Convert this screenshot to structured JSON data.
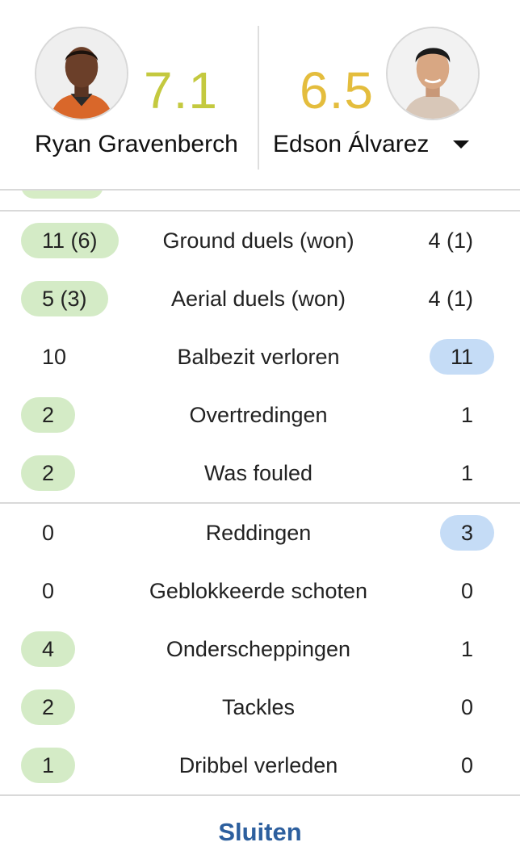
{
  "colors": {
    "rating_left": "#c4c93f",
    "rating_right": "#e4bd3d",
    "pill_green": "#d4ebc6",
    "pill_blue": "#c5dcf6",
    "close_button": "#2d5f9e"
  },
  "header": {
    "left_player": {
      "name": "Ryan Gravenberch",
      "rating": "7.1"
    },
    "right_player": {
      "name": "Edson Álvarez",
      "rating": "6.5"
    },
    "dropdown_icon": "caret-down-icon"
  },
  "stats": [
    {
      "left": "11 (6)",
      "label": "Ground duels (won)",
      "right": "4 (1)",
      "highlight": "left"
    },
    {
      "left": "5 (3)",
      "label": "Aerial duels (won)",
      "right": "4 (1)",
      "highlight": "left"
    },
    {
      "left": "10",
      "label": "Balbezit verloren",
      "right": "11",
      "highlight": "right"
    },
    {
      "left": "2",
      "label": "Overtredingen",
      "right": "1",
      "highlight": "left"
    },
    {
      "left": "2",
      "label": "Was fouled",
      "right": "1",
      "highlight": "left"
    },
    {
      "left": "0",
      "label": "Reddingen",
      "right": "3",
      "highlight": "right"
    },
    {
      "left": "0",
      "label": "Geblokkeerde schoten",
      "right": "0",
      "highlight": "none"
    },
    {
      "left": "4",
      "label": "Onderscheppingen",
      "right": "1",
      "highlight": "left"
    },
    {
      "left": "2",
      "label": "Tackles",
      "right": "0",
      "highlight": "left"
    },
    {
      "left": "1",
      "label": "Dribbel verleden",
      "right": "0",
      "highlight": "left"
    }
  ],
  "footer": {
    "close_label": "Sluiten"
  }
}
